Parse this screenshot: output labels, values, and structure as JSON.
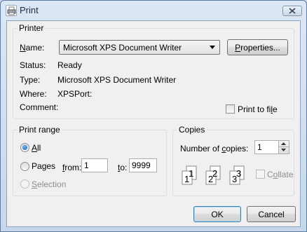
{
  "window": {
    "title": "Print",
    "close_icon": "close-icon",
    "app_icon": "printer-icon"
  },
  "printer": {
    "group_label": "Printer",
    "name_label": "Name:",
    "name_value": "Microsoft XPS Document Writer",
    "properties_button": "Properties...",
    "status_label": "Status:",
    "status_value": "Ready",
    "type_label": "Type:",
    "type_value": "Microsoft XPS Document Writer",
    "where_label": "Where:",
    "where_value": "XPSPort:",
    "comment_label": "Comment:",
    "print_to_file_label": "Print to file",
    "print_to_file_checked": false
  },
  "print_range": {
    "group_label": "Print range",
    "all_label": "All",
    "pages_label": "Pages",
    "from_label": "from:",
    "from_value": "1",
    "to_label": "to:",
    "to_value": "9999",
    "selection_label": "Selection",
    "selected": "All"
  },
  "copies": {
    "group_label": "Copies",
    "number_label": "Number of copies:",
    "number_value": "1",
    "collate_label": "Collate",
    "collate_checked": false,
    "collate_pages": [
      "1",
      "1",
      "2",
      "2",
      "3",
      "3"
    ]
  },
  "buttons": {
    "ok": "OK",
    "cancel": "Cancel"
  }
}
